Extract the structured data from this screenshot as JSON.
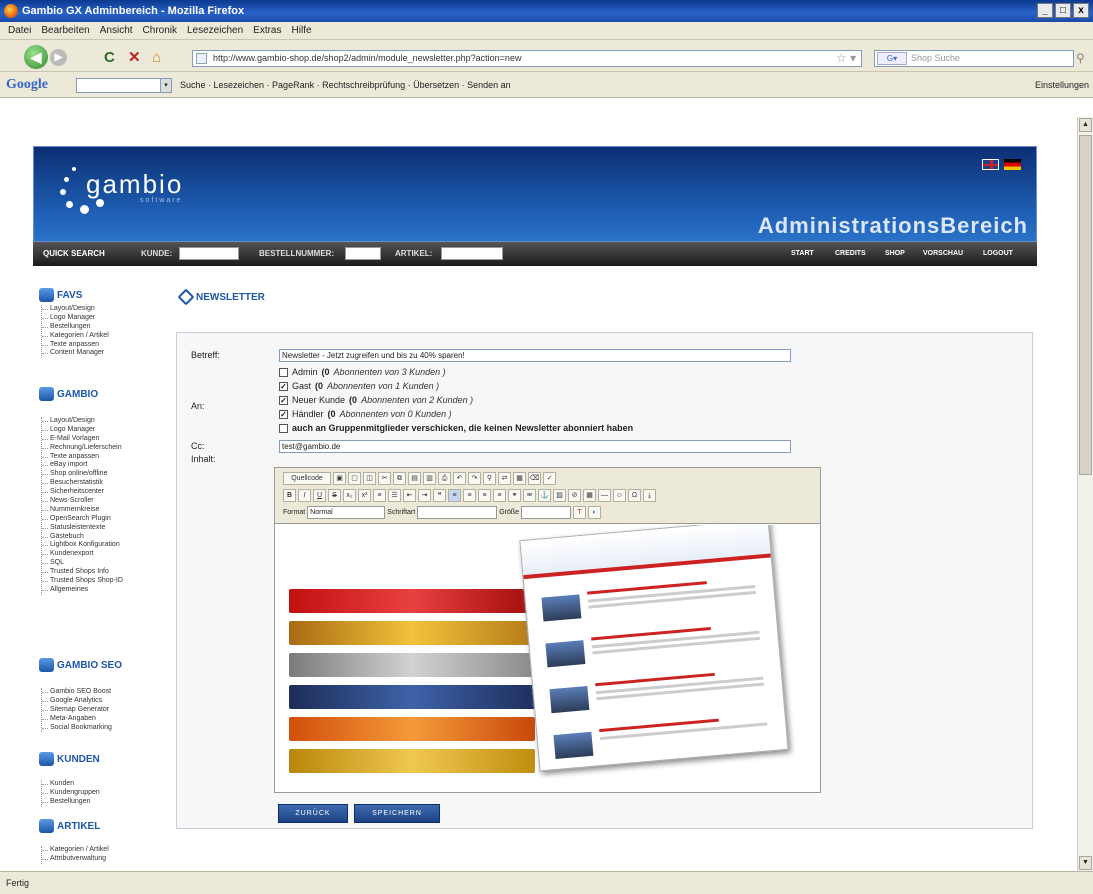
{
  "window": {
    "title": "Gambio GX Adminbereich - Mozilla Firefox"
  },
  "menu": [
    "Datei",
    "Bearbeiten",
    "Ansicht",
    "Chronik",
    "Lesezeichen",
    "Extras",
    "Hilfe"
  ],
  "nav": {
    "url": "http://www.gambio-shop.de/shop2/admin/module_newsletter.php?action=new",
    "search_placeholder": "Shop Suche"
  },
  "google_bar": {
    "logo": "Google",
    "items": "Suche  ·  Lesezeichen  ·  PageRank  ·  Rechtschreibprüfung  ·  Übersetzen  ·  Senden an",
    "settings": "Einstellungen"
  },
  "header": {
    "logo": "gambio",
    "logo_sub": "software",
    "title": "AdministrationsBereich"
  },
  "quick_search": {
    "label": "QUICK SEARCH",
    "kunde": "KUNDE:",
    "bestellnummer": "BESTELLNUMMER:",
    "artikel": "ARTIKEL:",
    "nav": [
      "START",
      "CREDITS",
      "SHOP",
      "VORSCHAU",
      "LOGOUT"
    ]
  },
  "sidebar": {
    "sections": [
      {
        "title": "FAVS",
        "items": [
          "Layout/Design",
          "Logo Manager",
          "Bestellungen",
          "Kategorien / Artikel",
          "Texte anpassen",
          "Content Manager"
        ]
      },
      {
        "title": "GAMBIO",
        "items": [
          "Layout/Design",
          "Logo Manager",
          "E-Mail Vorlagen",
          "Rechnung/Lieferschein",
          "Texte anpassen",
          "eBay import",
          "Shop online/offline",
          "Besucherstatistik",
          "Sicherheitscenter",
          "News-Scroller",
          "Nummernkreise",
          "OpenSearch Plugin",
          "Statusleistentexte",
          "Gästebuch",
          "Lightbox Konfiguration",
          "Kundenexport",
          "SQL",
          "Trusted Shops Info",
          "Trusted Shops Shop-ID",
          "Allgemeines"
        ]
      },
      {
        "title": "GAMBIO SEO",
        "items": [
          "Gambio SEO Boost",
          "Google Analytics",
          "Sitemap Generator",
          "Meta-Angaben",
          "Social Bookmarking"
        ]
      },
      {
        "title": "KUNDEN",
        "items": [
          "Kunden",
          "Kundengruppen",
          "Bestellungen"
        ]
      },
      {
        "title": "ARTIKEL",
        "items": [
          "Kategorien / Artikel",
          "Attributverwaltung"
        ]
      }
    ]
  },
  "main": {
    "page_title": "NEWSLETTER",
    "betreff_label": "Betreff:",
    "betreff_value": "Newsletter - Jetzt zugreifen und bis zu 40% sparen!",
    "an_label": "An:",
    "recipients": [
      {
        "name": "Admin",
        "count": "(0",
        "detail": "Abonnenten von 3 Kunden )",
        "checked": false
      },
      {
        "name": "Gast",
        "count": "(0",
        "detail": "Abonnenten von 1 Kunden )",
        "checked": true
      },
      {
        "name": "Neuer Kunde",
        "count": "(0",
        "detail": "Abonnenten von 2 Kunden )",
        "checked": true
      },
      {
        "name": "Händler",
        "count": "(0",
        "detail": "Abonnenten von 0 Kunden )",
        "checked": true
      }
    ],
    "group_option": "auch an Gruppenmitglieder verschicken, die keinen Newsletter abonniert haben",
    "cc_label": "Cc:",
    "cc_value": "test@gambio.de",
    "inhalt_label": "Inhalt:",
    "toolbar": {
      "quellcode": "Quellcode",
      "format_label": "Format",
      "format_value": "Normal",
      "font_label": "Schriftart",
      "size_label": "Größe"
    },
    "buttons": {
      "back": "ZURÜCK",
      "save": "SPEICHERN"
    }
  },
  "status": "Fertig",
  "colors": {
    "accent": "#1e56a8",
    "header_bg": "#0c2f73",
    "qs_bar": "#1a1a1a"
  }
}
